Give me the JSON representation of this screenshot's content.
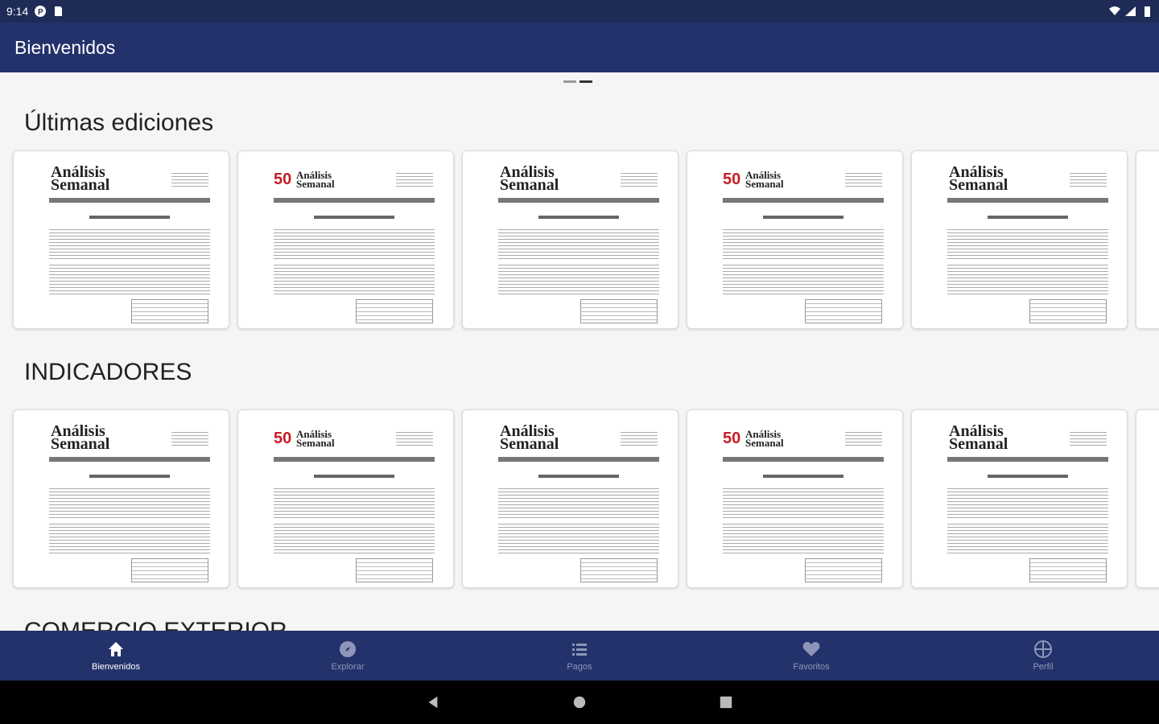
{
  "status_bar": {
    "time": "9:14"
  },
  "app_bar": {
    "title": "Bienvenidos"
  },
  "sections": [
    {
      "title": "Últimas ediciones"
    },
    {
      "title": "INDICADORES"
    },
    {
      "title": "COMERCIO EXTERIOR"
    }
  ],
  "bottom_nav": [
    {
      "label": "Bienvenidos",
      "icon": "home-icon",
      "active": true
    },
    {
      "label": "Explorar",
      "icon": "compass-icon",
      "active": false
    },
    {
      "label": "Pagos",
      "icon": "list-icon",
      "active": false
    },
    {
      "label": "Favoritos",
      "icon": "heart-icon",
      "active": false
    },
    {
      "label": "Perfil",
      "icon": "globe-icon",
      "active": false
    }
  ],
  "colors": {
    "app_bar": "#24326b",
    "status_bar": "#1f2b57",
    "accent_red": "#c81d25"
  }
}
